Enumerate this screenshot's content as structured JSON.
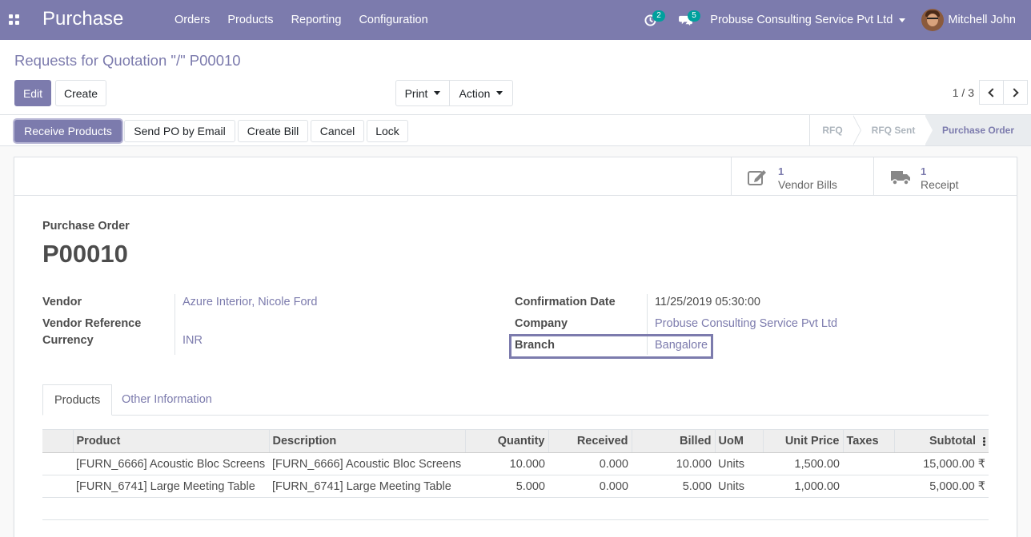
{
  "navbar": {
    "app_name": "Purchase",
    "menu": [
      "Orders",
      "Products",
      "Reporting",
      "Configuration"
    ],
    "activity_count": "2",
    "message_count": "5",
    "company": "Probuse Consulting Service Pvt Ltd",
    "user": "Mitchell John"
  },
  "control": {
    "breadcrumb": "Requests for Quotation \"/\" P00010",
    "edit_label": "Edit",
    "create_label": "Create",
    "print_label": "Print",
    "action_label": "Action",
    "pager": "1 / 3"
  },
  "statusbar": {
    "buttons": [
      "Receive Products",
      "Send PO by Email",
      "Create Bill",
      "Cancel",
      "Lock"
    ],
    "stages": [
      "RFQ",
      "RFQ Sent",
      "Purchase Order"
    ],
    "active_stage": "Purchase Order"
  },
  "smart_buttons": [
    {
      "count": "1",
      "label": "Vendor Bills",
      "icon": "edit-icon"
    },
    {
      "count": "1",
      "label": "Receipt",
      "icon": "truck-icon"
    }
  ],
  "sheet": {
    "doc_type": "Purchase Order",
    "doc_number": "P00010",
    "left_fields": {
      "vendor_label": "Vendor",
      "vendor_value": "Azure Interior, Nicole Ford",
      "vendor_ref_label": "Vendor Reference",
      "currency_label": "Currency",
      "currency_value": "INR"
    },
    "right_fields": {
      "confirmation_label": "Confirmation Date",
      "confirmation_value": "11/25/2019 05:30:00",
      "company_label": "Company",
      "company_value": "Probuse Consulting Service Pvt Ltd",
      "branch_label": "Branch",
      "branch_value": "Bangalore"
    },
    "tabs": [
      "Products",
      "Other Information"
    ]
  },
  "table": {
    "headers": [
      "Product",
      "Description",
      "Quantity",
      "Received",
      "Billed",
      "UoM",
      "Unit Price",
      "Taxes",
      "Subtotal"
    ],
    "rows": [
      [
        "[FURN_6666] Acoustic Bloc Screens",
        "[FURN_6666] Acoustic Bloc Screens",
        "10.000",
        "0.000",
        "10.000",
        "Units",
        "1,500.00",
        "",
        "15,000.00 ₹"
      ],
      [
        "[FURN_6741] Large Meeting Table",
        "[FURN_6741] Large Meeting Table",
        "5.000",
        "0.000",
        "5.000",
        "Units",
        "1,000.00",
        "",
        "5,000.00 ₹"
      ]
    ]
  },
  "colors": {
    "brand": "#7c7bad",
    "badge": "#00a09d"
  }
}
